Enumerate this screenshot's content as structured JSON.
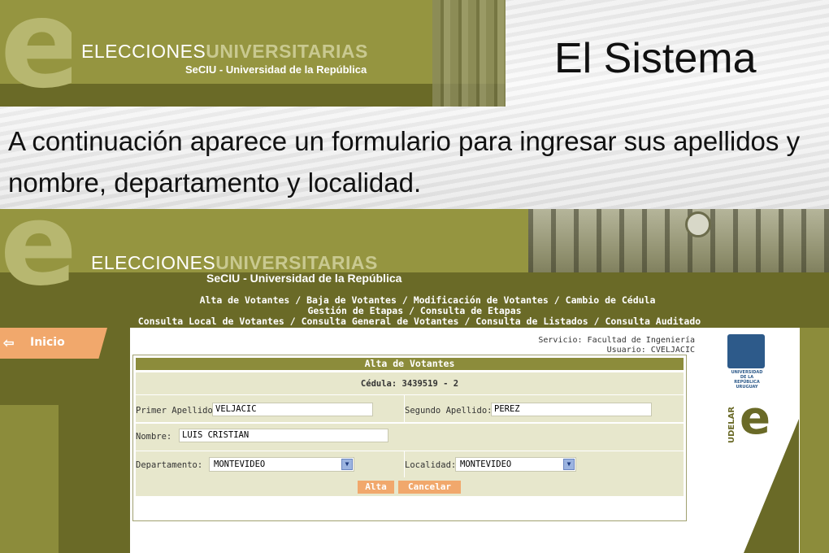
{
  "slide": {
    "brand_title_plain": "ELECCIONES",
    "brand_title_bold": "UNIVERSITARIAS",
    "brand_sub": "SeCIU - Universidad de la República",
    "title": "El Sistema",
    "description": "A continuación aparece un formulario para ingresar sus apellidos y nombre, departamento y localidad."
  },
  "app": {
    "brand_title_plain": "ELECCIONES",
    "brand_title_bold": "UNIVERSITARIAS",
    "brand_sub": "SeCIU - Universidad de la República",
    "nav": {
      "line1": [
        "Alta de Votantes",
        "Baja de Votantes",
        "Modificación de Votantes",
        "Cambio de Cédula"
      ],
      "line2": [
        "Gestión de Etapas",
        "Consulta de Etapas"
      ],
      "line3": [
        "Consulta Local de Votantes",
        "Consulta General de Votantes",
        "Consulta de Listados",
        "Consulta Auditado"
      ],
      "separator": " / "
    },
    "inicio_icon": "back-arrow-icon",
    "inicio_label": "Inicio",
    "service_line": "Servicio: Facultad de Ingeniería",
    "user_line": "Usuario: CVELJACIC",
    "udelar_seal_text": "UNIVERSIDAD DE LA REPÚBLICA URUGUAY",
    "udelar_vertical": "UDELAR",
    "udelar_letter": "e",
    "form": {
      "title": "Alta de Votantes",
      "cedula_label": "Cédula:",
      "cedula_value": "3439519 - 2",
      "primer_apellido_label": "Primer Apellido:",
      "primer_apellido_value": "VELJACIC",
      "segundo_apellido_label": "Segundo Apellido:",
      "segundo_apellido_value": "PEREZ",
      "nombre_label": "Nombre:",
      "nombre_value": "LUIS CRISTIAN",
      "departamento_label": "Departamento:",
      "departamento_value": "MONTEVIDEO",
      "localidad_label": "Localidad:",
      "localidad_value": "MONTEVIDEO",
      "alta_button": "Alta",
      "cancelar_button": "Cancelar"
    }
  },
  "colors": {
    "olive_dark": "#6a6a27",
    "olive": "#8c8c3b",
    "olive_light": "#959540",
    "form_row": "#e7e7cc",
    "accent_orange": "#f1a86c",
    "udelar_blue": "#2d5a8a"
  }
}
